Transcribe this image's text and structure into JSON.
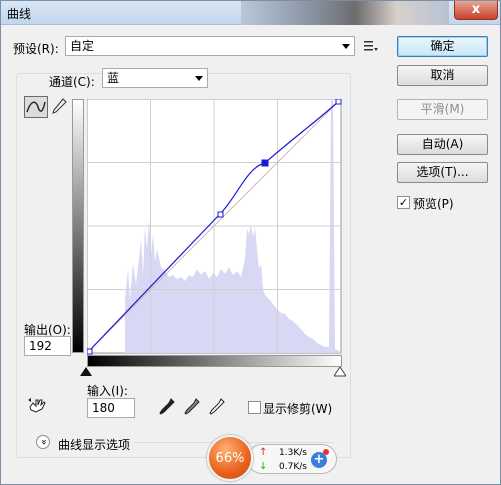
{
  "window": {
    "title": "曲线",
    "close_label": "x"
  },
  "preset": {
    "label": "预设(R):",
    "value": "自定"
  },
  "channel": {
    "label": "通道(C):",
    "value": "蓝"
  },
  "buttons": {
    "ok": "确定",
    "cancel": "取消",
    "smooth": "平滑(M)",
    "auto": "自动(A)",
    "options": "选项(T)..."
  },
  "preview": {
    "label": "预览(P)",
    "checked": true,
    "check_glyph": "✓"
  },
  "output": {
    "label": "输出(O):",
    "value": "192"
  },
  "input": {
    "label": "输入(I):",
    "value": "180"
  },
  "show_clipping": {
    "label": "显示修剪(W)",
    "checked": false
  },
  "curve_options": {
    "label": "曲线显示选项",
    "toggle_glyph": "»"
  },
  "speed": {
    "percent": "66%",
    "upload": "1.3K/s",
    "download": "0.7K/s",
    "up_arrow": "↑",
    "down_arrow": "↓",
    "plus": "+"
  }
}
